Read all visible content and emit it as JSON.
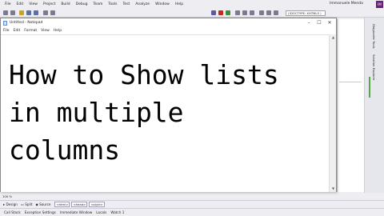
{
  "vs": {
    "menu": [
      "File",
      "Edit",
      "View",
      "Project",
      "Build",
      "Debug",
      "Team",
      "Tools",
      "Test",
      "Analyze",
      "Window",
      "Help"
    ],
    "doctype": "(!DOCTYPE: XHTML5 )",
    "user": "Immanuele Menda",
    "avatar": "IM",
    "side_tabs": [
      "Diagnostic Tools",
      "Solution Explorer"
    ],
    "zoom": "100 %",
    "design_bar": {
      "design": "Design",
      "split": "Split",
      "source": "Source",
      "tags": [
        "<html>",
        "<head>",
        "<style>"
      ]
    },
    "status": [
      "Call Stack",
      "Exception Settings",
      "Immediate Window",
      "Locals",
      "Watch 1"
    ]
  },
  "notepad": {
    "title": "Untitled - Notepad",
    "menu": [
      "File",
      "Edit",
      "Format",
      "View",
      "Help"
    ],
    "controls": {
      "minimize": "–",
      "maximize": "☐",
      "close": "✕"
    },
    "content": "How to Show lists\nin multiple\ncolumns"
  }
}
